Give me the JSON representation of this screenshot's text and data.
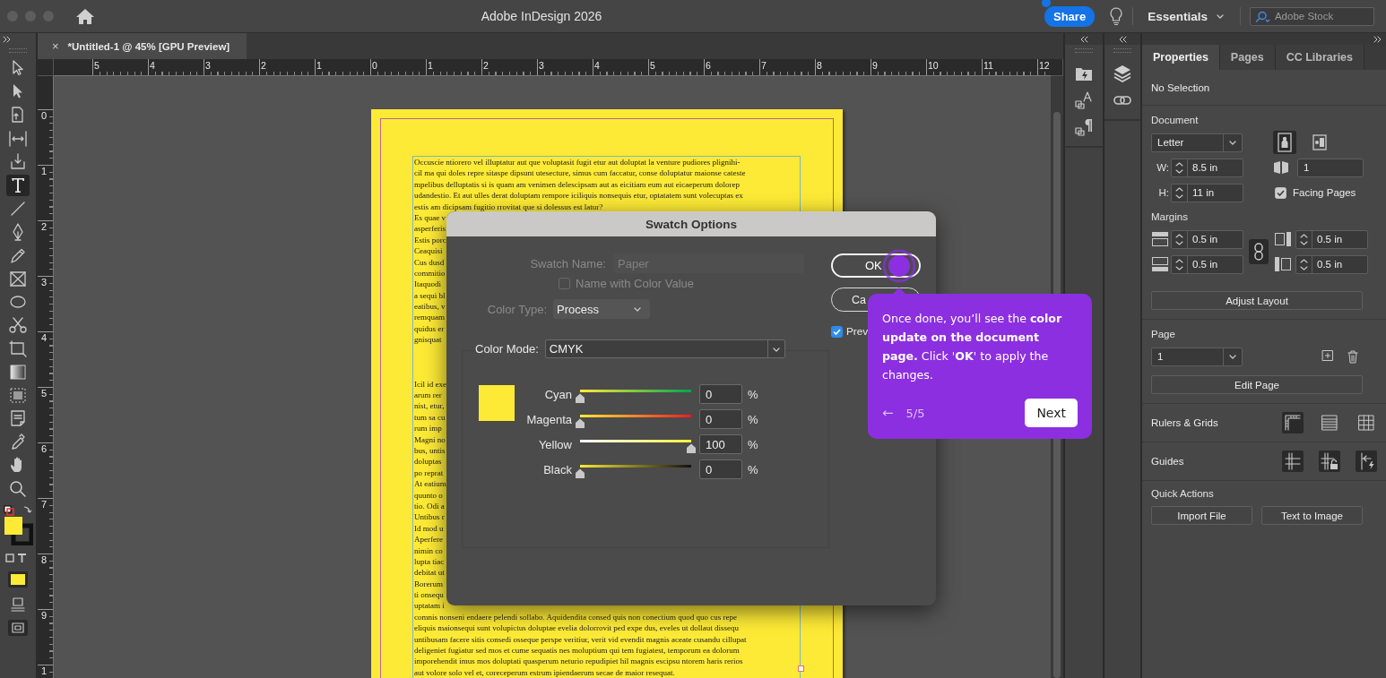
{
  "window": {
    "title": "Adobe InDesign 2026"
  },
  "top_bar": {
    "share": {
      "label": "Share",
      "notification": true
    },
    "workspace": "Essentials",
    "search": {
      "placeholder": "Adobe Stock"
    }
  },
  "document_tab": {
    "close": "×",
    "title": "*Untitled-1 @ 45% [GPU Preview]"
  },
  "tools": [
    {
      "kind": "select",
      "selected": false
    },
    {
      "kind": "direct",
      "selected": false
    },
    {
      "kind": "page",
      "selected": false
    },
    {
      "kind": "gap",
      "selected": false
    },
    {
      "kind": "content",
      "selected": false
    },
    {
      "kind": "type",
      "selected": true
    },
    {
      "kind": "line",
      "selected": false
    },
    {
      "kind": "pen",
      "selected": false
    },
    {
      "kind": "pencil",
      "selected": false
    },
    {
      "kind": "frame",
      "selected": false
    },
    {
      "kind": "ellipse",
      "selected": false
    },
    {
      "kind": "scissors",
      "selected": false
    },
    {
      "kind": "transform",
      "selected": false
    },
    {
      "kind": "gradient",
      "selected": false
    },
    {
      "kind": "feather",
      "selected": false
    },
    {
      "kind": "note",
      "selected": false
    },
    {
      "kind": "eyedropper",
      "selected": false
    },
    {
      "kind": "hand",
      "selected": false
    },
    {
      "kind": "zoom",
      "selected": false
    }
  ],
  "rulers": {
    "horizontal": [
      "5",
      "4",
      "3",
      "2",
      "1",
      "0",
      "1",
      "2",
      "3",
      "4",
      "5",
      "6",
      "7",
      "8",
      "9",
      "10",
      "11",
      "12"
    ],
    "vertical": [
      "0",
      "1",
      "2",
      "3",
      "4",
      "5",
      "6",
      "7",
      "8",
      "9",
      "1"
    ]
  },
  "text_frame": {
    "paragraphs": [
      [
        "Occuscie ntiorero vel illuptatur aut que voluptasit fugit etur aut doluptat la venture pudiores plignihi-",
        "cil ma qui doles repre sitaspe dipsunt utesecture, simus cum faccatur, conse doluptatur maionse cateste",
        "mpelibus delluptatis si is quam am venimen delescipsam aut as eicitiam eum aut eicaeperum dolorep",
        "udandestio. Et aut ulles derat doluptam rempore iciliquis nonsequis etur, optatatem sunt volecuptas ex",
        "estis am dicipsam fugitio rrovitat que si dolessus est latur?",
        "Es quae v",
        "asperferis",
        "Estis porc",
        "Ceaquisi",
        "Cus dusd",
        "commitio",
        "Itaquodi",
        "a sequi bl",
        "eatibus, v",
        "remquam",
        "quidus er",
        "gnisquat"
      ],
      [
        "Icil id exe",
        "arum rer",
        "nist, etur,",
        "tum sa cu",
        "rum imp",
        "Magni no",
        "bus, untis",
        "doluptas",
        "po reprat",
        "At eatium",
        "quunto o",
        "tio. Odi a",
        "Untibus r",
        "Id mod u",
        "Aperfere",
        "nimin co",
        "lupta tiac",
        "debitat ut",
        "Borerum",
        "ti onsequ",
        "uptatam i",
        "comnis nonseni endaere pelendi sollabo. Aquidendita consed quis non conectium quod quo cus repe",
        "eliquis maionsequi sunt volupictus doluptae evelia dolorrovit ped expe dus, eveles ut dollaut dissequ",
        "untibusam facere sitis consedi osseque perspe veritiur, verit vid evendit magnis aceate cusandu cillupat",
        "deligeniet fugiatur sed mos et cume sequatis nes moluptium qui tem fugiatest, temporum ea dolorum",
        "imporehendit imus mos doluptati quasperum neturio repudipiet hil magnis escipsu ntorem haris rerios",
        "aut volore solo vel et, coreceperum estrum ipiendaerum secae de maior resequat."
      ]
    ]
  },
  "dialog": {
    "title": "Swatch Options",
    "swatch_name": {
      "label": "Swatch Name:",
      "value": "Paper",
      "disabled": true
    },
    "name_with_color_value": {
      "label": "Name with Color Value",
      "checked": false,
      "disabled": true
    },
    "color_type": {
      "label": "Color Type:",
      "value": "Process"
    },
    "color_mode": {
      "label": "Color Mode:",
      "value": "CMYK"
    },
    "channels": [
      {
        "kind": "cyan",
        "label": "Cyan",
        "level": 0,
        "value": "0",
        "unit": "%"
      },
      {
        "kind": "magenta",
        "label": "Magenta",
        "level": 0,
        "value": "0",
        "unit": "%"
      },
      {
        "kind": "yellow",
        "label": "Yellow",
        "level": 1,
        "value": "100",
        "unit": "%"
      },
      {
        "kind": "black",
        "label": "Black",
        "level": 0,
        "value": "0",
        "unit": "%"
      }
    ],
    "ok": "OK",
    "cancel": "Ca",
    "preview": {
      "label": "Prev",
      "checked": true
    }
  },
  "tour_tooltip": {
    "text": "Once done, you’ll see the **color update on the document page.** Click '**OK**' to apply the changes.",
    "back": "←",
    "step": "5/5",
    "next": "Next"
  },
  "properties_panel": {
    "tabs": [
      {
        "label": "Properties",
        "selected": true
      },
      {
        "label": "Pages",
        "selected": false
      },
      {
        "label": "CC Libraries",
        "selected": false
      }
    ],
    "selection": "No Selection",
    "document": {
      "heading": "Document",
      "size": "Letter",
      "orientation": [
        {
          "kind": "portrait",
          "selected": true
        },
        {
          "kind": "landscape",
          "selected": false
        }
      ],
      "width": {
        "label": "W:",
        "value": "8.5 in"
      },
      "height": {
        "label": "H:",
        "value": "11 in"
      },
      "pages": "1",
      "facing_pages": {
        "label": "Facing Pages",
        "checked": true
      }
    },
    "margins": {
      "heading": "Margins",
      "values": [
        {
          "kind": "top",
          "value": "0.5 in"
        },
        {
          "kind": "inside",
          "value": "0.5 in"
        },
        {
          "kind": "bottom",
          "value": "0.5 in"
        },
        {
          "kind": "outside",
          "value": "0.5 in"
        }
      ],
      "linked": true
    },
    "adjust_layout": "Adjust Layout",
    "page": {
      "heading": "Page",
      "value": "1",
      "edit": "Edit Page"
    },
    "rulers_grids": {
      "heading": "Rulers & Grids",
      "toggles": [
        {
          "kind": "rulers",
          "on": true
        },
        {
          "kind": "baseline",
          "on": false
        },
        {
          "kind": "grid",
          "on": false
        }
      ]
    },
    "guides": {
      "heading": "Guides",
      "toggles": [
        {
          "kind": "guides",
          "on": true
        },
        {
          "kind": "lock",
          "on": true
        },
        {
          "kind": "smart",
          "on": true
        }
      ]
    },
    "quick_actions": {
      "heading": "Quick Actions",
      "buttons": [
        "Import File",
        "Text to Image"
      ]
    }
  }
}
